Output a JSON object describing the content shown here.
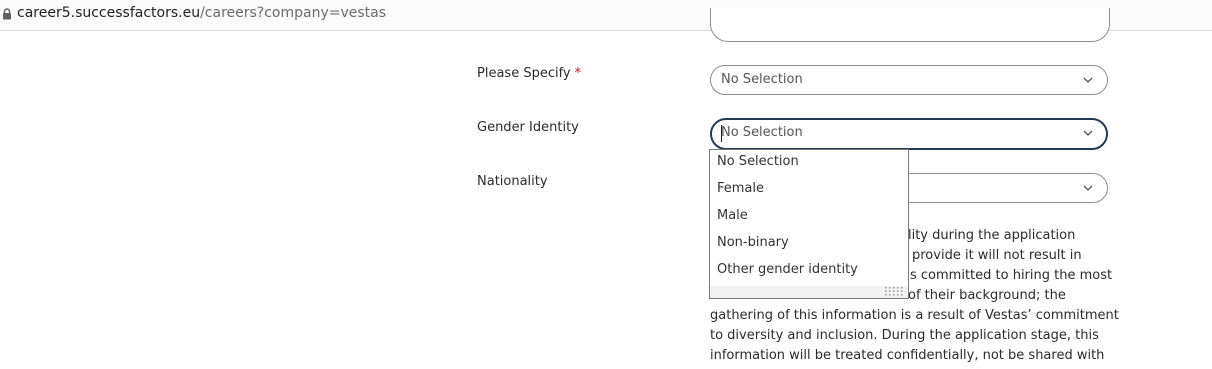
{
  "browser": {
    "url_domain": "career5.successfactors.eu",
    "url_path": "/careers?company=vestas"
  },
  "form": {
    "please_specify": {
      "label": "Please Specify",
      "required_mark": "*",
      "value": "No Selection"
    },
    "gender_identity": {
      "label": "Gender Identity",
      "value": "No Selection"
    },
    "nationality": {
      "label": "Nationality"
    }
  },
  "dropdown": {
    "options": [
      "No Selection",
      "Female",
      "Male",
      "Non-binary",
      "Other gender identity"
    ]
  },
  "paragraph": {
    "lines": [
      "ality during the application",
      "provide it will not result in",
      "s committed to hiring the most",
      "of their background; the",
      "gathering of this information is a result of Vestas’ commitment",
      "to diversity and inclusion. During the application stage, this",
      "information will be treated confidentially, not be shared with"
    ]
  }
}
